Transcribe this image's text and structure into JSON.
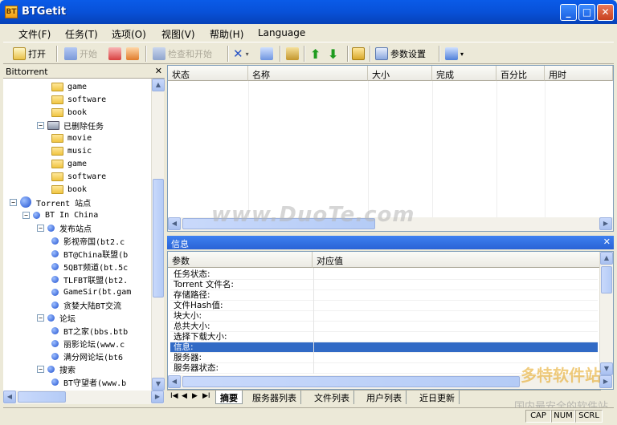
{
  "window": {
    "title": "BTGetit",
    "icon": "BT",
    "minimize": "_",
    "maximize": "□",
    "close": "✕"
  },
  "menu": [
    "文件(F)",
    "任务(T)",
    "选项(O)",
    "视图(V)",
    "帮助(H)",
    "Language"
  ],
  "toolbar": {
    "open": "打开",
    "start": "开始",
    "check_start": "检查和开始",
    "settings": "参数设置"
  },
  "left_panel": {
    "title": "Bittorrent",
    "close": "✕",
    "tree": [
      {
        "label": "game",
        "kind": "folder",
        "depth": 3
      },
      {
        "label": "software",
        "kind": "folder",
        "depth": 3
      },
      {
        "label": "book",
        "kind": "folder",
        "depth": 3
      },
      {
        "label": "已删除任务",
        "kind": "trash",
        "depth": 2,
        "expander": "−"
      },
      {
        "label": "movie",
        "kind": "folder",
        "depth": 3
      },
      {
        "label": "music",
        "kind": "folder",
        "depth": 3
      },
      {
        "label": "game",
        "kind": "folder",
        "depth": 3
      },
      {
        "label": "software",
        "kind": "folder",
        "depth": 3
      },
      {
        "label": "book",
        "kind": "folder",
        "depth": 3
      },
      {
        "label": "Torrent 站点",
        "kind": "globe",
        "depth": 0,
        "expander": "−"
      },
      {
        "label": "BT In China",
        "kind": "dot",
        "depth": 1,
        "expander": "−"
      },
      {
        "label": "发布站点",
        "kind": "dot",
        "depth": 2,
        "expander": "−"
      },
      {
        "label": "影视帝国(bt2.c",
        "kind": "dot",
        "depth": 3
      },
      {
        "label": "BT@China联盟(b",
        "kind": "dot",
        "depth": 3
      },
      {
        "label": "5QBT频道(bt.5c",
        "kind": "dot",
        "depth": 3
      },
      {
        "label": "TLFBT联盟(bt2.",
        "kind": "dot",
        "depth": 3
      },
      {
        "label": "GameSir(bt.gam",
        "kind": "dot",
        "depth": 3
      },
      {
        "label": "贪婪大陆BT交流",
        "kind": "dot",
        "depth": 3
      },
      {
        "label": "论坛",
        "kind": "dot",
        "depth": 2,
        "expander": "−"
      },
      {
        "label": "BT之家(bbs.btb",
        "kind": "dot",
        "depth": 3
      },
      {
        "label": "丽影论坛(www.c",
        "kind": "dot",
        "depth": 3
      },
      {
        "label": "满分网论坛(bt6",
        "kind": "dot",
        "depth": 3
      },
      {
        "label": "搜索",
        "kind": "dot",
        "depth": 2,
        "expander": "−"
      },
      {
        "label": "BT守望者(www.b",
        "kind": "dot",
        "depth": 3
      }
    ]
  },
  "task_list": {
    "columns": [
      "状态",
      "名称",
      "大小",
      "完成",
      "百分比",
      "用时"
    ]
  },
  "info_panel": {
    "title": "信息",
    "close": "✕",
    "columns": [
      "参数",
      "对应值"
    ],
    "rows": [
      "任务状态:",
      "Torrent 文件名:",
      "存储路径:",
      "文件Hash值:",
      "块大小:",
      "总共大小:",
      "选择下载大小:",
      "信息:",
      "服务器:",
      "服务器状态:"
    ],
    "selected_row": 7
  },
  "tabs": {
    "nav": [
      "I◀",
      "◀",
      "▶",
      "▶I"
    ],
    "items": [
      "摘要",
      "服务器列表",
      "文件列表",
      "用户列表",
      "近日更新"
    ],
    "active": 0
  },
  "status": {
    "cap": "CAP",
    "num": "NUM",
    "scrl": "SCRL"
  },
  "watermarks": {
    "main": "www.DuoTe.com",
    "corner": "多特软件站",
    "corner_sub": "国内最安全的软件站"
  }
}
